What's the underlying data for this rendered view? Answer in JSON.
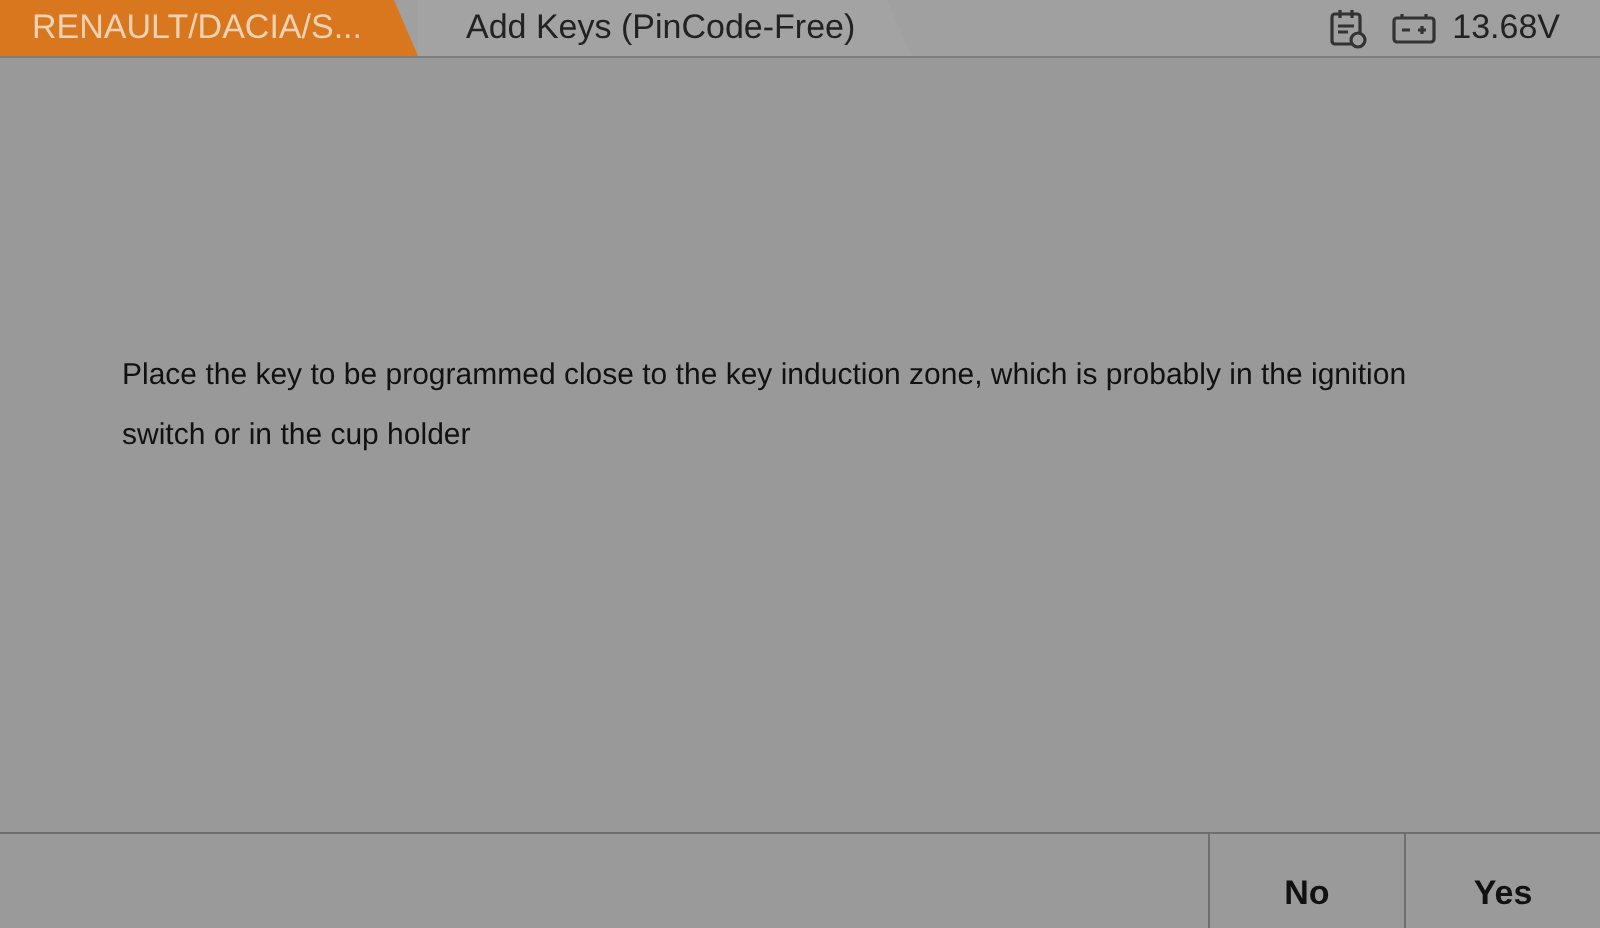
{
  "breadcrumbs": [
    {
      "label": "RENAULT/DACIA/S...",
      "color": "#d9771f"
    },
    {
      "label": "Add Keys (PinCode-Free)",
      "color": "#a3a3a3"
    }
  ],
  "status": {
    "voltage": "13.68V"
  },
  "message": "Place the key to be programmed close to the key induction zone,  which is probably in the ignition switch or in the cup holder",
  "buttons": [
    "No",
    "Yes"
  ]
}
